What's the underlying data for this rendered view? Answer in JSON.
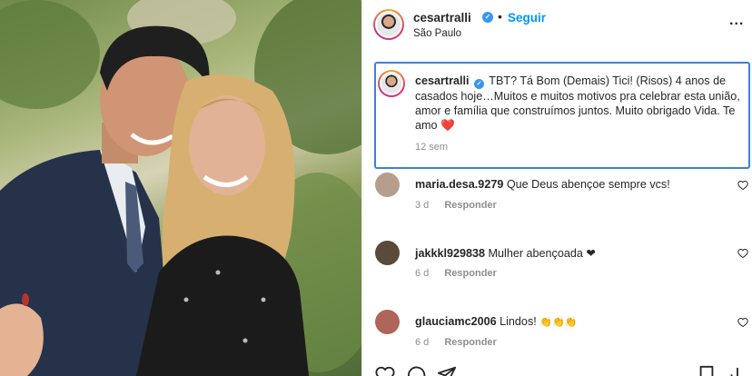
{
  "post": {
    "username": "cesartralli",
    "verified_mark": "✓",
    "dot": "•",
    "follow_label": "Seguir",
    "location": "São Paulo",
    "more_label": "..."
  },
  "caption": {
    "username": "cesartralli",
    "text": "TBT? Tá Bom (Demais) Tici! (Risos) 4 anos de casados hoje…Muitos e muitos motivos pra celebrar esta união, amor e família que construímos juntos. Muito obrigado Vida. Te amo",
    "emoji": "❤️",
    "time": "12 sem"
  },
  "comments": [
    {
      "username": "maria.desa.9279",
      "text": "Que Deus abençoe sempre vcs!",
      "time": "3 d",
      "reply_label": "Responder",
      "avatar_color": "#b59e8d"
    },
    {
      "username": "jakkkl929838",
      "text": "Mulher abençoada",
      "emoji": "❤",
      "time": "6 d",
      "reply_label": "Responder",
      "avatar_color": "#5a4a3a"
    },
    {
      "username": "glauciamc2006",
      "text": "Lindos!",
      "emoji": "👏👏👏",
      "time": "6 d",
      "reply_label": "Responder",
      "avatar_color": "#b0655a"
    }
  ],
  "icons": {
    "verified": "verified-badge-icon",
    "more": "more-options-icon",
    "like": "heart-outline-icon",
    "comment": "comment-icon",
    "share": "share-icon",
    "save": "bookmark-icon",
    "stats": "insights-icon"
  },
  "colors": {
    "accent": "#0095f6",
    "caption_border": "#3d7fe3",
    "verified": "#3897f0",
    "muted": "#8e8e8e"
  }
}
